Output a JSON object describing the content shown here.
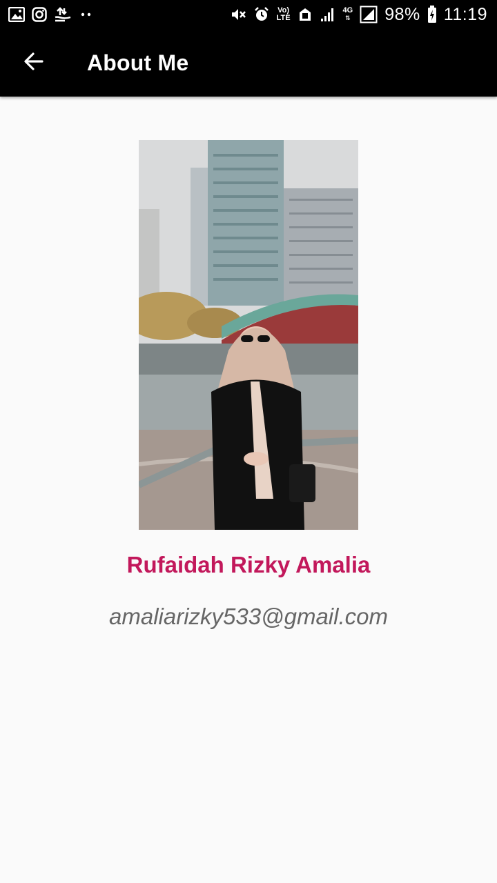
{
  "status_bar": {
    "battery_percent": "98%",
    "time": "11:19",
    "volte_top": "Vo)",
    "volte_bottom": "LTE",
    "network": "4G",
    "icons": [
      "gallery-icon",
      "instagram-icon",
      "upload-icon",
      "more-dots-icon",
      "mute-icon",
      "alarm-icon",
      "volte-icon",
      "data-saver-icon",
      "signal-icon",
      "4g-icon",
      "signal-icon",
      "battery-charging-icon"
    ]
  },
  "toolbar": {
    "back_icon": "arrow-back-icon",
    "title": "About Me"
  },
  "profile": {
    "name": "Rufaidah Rizky Amalia",
    "email": "amaliarizky533@gmail.com"
  },
  "colors": {
    "toolbar_bg": "#000000",
    "name_color": "#c2185b",
    "email_color": "#666666",
    "page_bg": "#fafafa"
  }
}
